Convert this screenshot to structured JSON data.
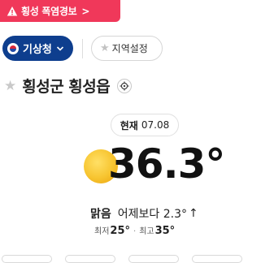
{
  "alert": {
    "text": "횡성 폭염경보",
    "chevron": ">"
  },
  "source": {
    "label": "기상청"
  },
  "region": {
    "label": "지역설정"
  },
  "location": {
    "name": "횡성군 횡성읍"
  },
  "now": {
    "label": "현재",
    "date": "07.08"
  },
  "weather": {
    "temperature": "36.3°",
    "condition": "맑음",
    "compare_text": "어제보다 2.3°",
    "compare_arrow": "↑",
    "min_label": "최저",
    "min_value": "25°",
    "max_label": "최고",
    "max_value": "35°",
    "icon": "sun-icon"
  },
  "colors": {
    "alert_bg": "#f0385a",
    "source_bg": "#0e3e8e",
    "sun": "#f7c531"
  }
}
